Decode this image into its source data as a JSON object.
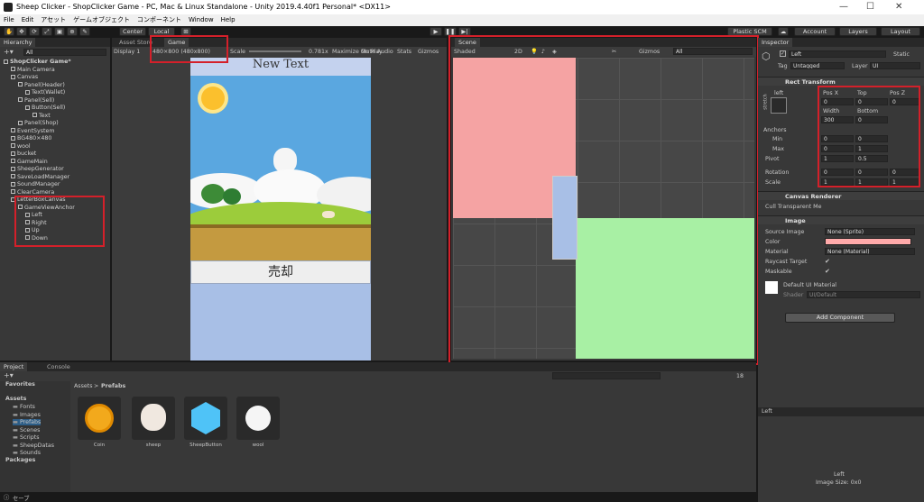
{
  "title_bar": {
    "title": "Sheep Clicker - ShopClicker Game - PC, Mac & Linux Standalone - Unity 2019.4.40f1 Personal* <DX11>"
  },
  "menu": [
    "File",
    "Edit",
    "アセット",
    "ゲームオブジェクト",
    "コンポーネント",
    "Window",
    "Help"
  ],
  "toolbar": {
    "center": "Center",
    "local": "Local",
    "plastic": "Plastic SCM",
    "account": "Account",
    "layers": "Layers",
    "layout": "Layout"
  },
  "hierarchy": {
    "tab": "Hierarchy",
    "search": "All",
    "items": [
      "ShopClicker Game*",
      "Main Camera",
      "Canvas",
      "Panel(Header)",
      "Text(Wallet)",
      "Panel(Sell)",
      "Button(Sell)",
      "Text",
      "Panel(Shop)",
      "EventSystem",
      "BG480×480",
      "wool",
      "bucket",
      "GameMain",
      "SheepGenerator",
      "SaveLoadManager",
      "SoundManager",
      "ClearCamera",
      "LetterBoxCanvas",
      "GameViewAnchor",
      "Left",
      "Right",
      "Up",
      "Down"
    ]
  },
  "game": {
    "tab_asset_store": "Asset Store",
    "tab_game": "Game",
    "display": "Display 1",
    "resolution": "480×800 (480x800)",
    "scale_label": "Scale",
    "scale_value": "0.781x",
    "maximize": "Maximize On Play",
    "mute": "Mute Audio",
    "stats": "Stats",
    "gizmos": "Gizmos",
    "header_text": "New Text",
    "sell_button": "売却"
  },
  "scene": {
    "tab": "Scene",
    "shading": "Shaded",
    "mode2d": "2D",
    "gizmos": "Gizmos",
    "search": "All"
  },
  "inspector": {
    "tab": "Inspector",
    "name": "Left",
    "static": "Static",
    "tag_label": "Tag",
    "tag_value": "Untagged",
    "layer_label": "Layer",
    "layer_value": "UI",
    "rect_transform": "Rect Transform",
    "anchor_preset": "left",
    "stretch": "stretch",
    "pos_x_label": "Pos X",
    "top_label": "Top",
    "pos_z_label": "Pos Z",
    "pos_x": "0",
    "top": "0",
    "pos_z": "0",
    "width_label": "Width",
    "bottom_label": "Bottom",
    "width": "300",
    "bottom": "0",
    "anchors": "Anchors",
    "min": "Min",
    "max": "Max",
    "pivot": "Pivot",
    "rotation": "Rotation",
    "scale": "Scale",
    "min_x": "0",
    "min_y": "0",
    "max_x": "0",
    "max_y": "1",
    "pivot_x": "1",
    "pivot_y": "0.5",
    "rot_x": "0",
    "rot_y": "0",
    "rot_z": "0",
    "scale_x": "1",
    "scale_y": "1",
    "scale_z": "1",
    "canvas_renderer": "Canvas Renderer",
    "cull": "Cull Transparent Me",
    "image": "Image",
    "source_image_label": "Source Image",
    "source_image": "None (Sprite)",
    "color_label": "Color",
    "color_value": "#ffaaaa",
    "material_label": "Material",
    "material": "None (Material)",
    "raycast": "Raycast Target",
    "maskable": "Maskable",
    "default_material": "Default UI Material",
    "shader_label": "Shader",
    "shader": "UI/Default",
    "add_component": "Add Component",
    "preview_dropdown": "Left",
    "preview_name": "Left",
    "preview_size": "Image Size: 0x0"
  },
  "project": {
    "tab_project": "Project",
    "tab_console": "Console",
    "favorites": "Favorites",
    "assets": "Assets",
    "folders": [
      "Fonts",
      "Images",
      "Prefabs",
      "Scenes",
      "Scripts",
      "SheepDatas",
      "Sounds"
    ],
    "packages": "Packages",
    "breadcrumb_root": "Assets",
    "breadcrumb_current": "Prefabs",
    "count": "18",
    "items": [
      {
        "name": "Coin",
        "icon": "coin-icon"
      },
      {
        "name": "sheep",
        "icon": "sheep-icon"
      },
      {
        "name": "SheepButton",
        "icon": "cube-icon"
      },
      {
        "name": "wool",
        "icon": "wool-icon"
      }
    ]
  },
  "status": {
    "text": "セーブ"
  }
}
